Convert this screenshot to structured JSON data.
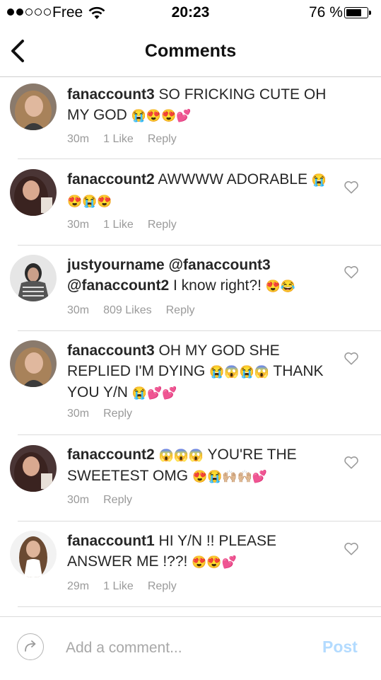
{
  "status_bar": {
    "carrier": "Free",
    "time": "20:23",
    "battery_percent": "76 %",
    "battery_level": 0.76,
    "signal_bars_filled": 2,
    "signal_bars_total": 5
  },
  "header": {
    "title": "Comments"
  },
  "comments": [
    {
      "username": "fanaccount3",
      "text": "SO FRICKING CUTE OH MY GOD",
      "emojis": "😭😍😍💕",
      "time": "30m",
      "likes": "1 Like",
      "reply": "Reply"
    },
    {
      "username": "fanaccount2",
      "text": "AWWWW ADORABLE",
      "emojis": "😭😍😭😍",
      "time": "30m",
      "likes": "1 Like",
      "reply": "Reply"
    },
    {
      "username": "justyourname",
      "mention_1": "@fanaccount3",
      "mention_2": "@fanaccount2",
      "text": "I know right?!",
      "emojis": "😍😂",
      "time": "30m",
      "likes": "809 Likes",
      "reply": "Reply"
    },
    {
      "username": "fanaccount3",
      "text": "OH MY GOD SHE REPLIED I'M DYING",
      "emojis_1": "😭😱😭😱",
      "text_2": "THANK YOU Y/N",
      "emojis_2": "😭💕💕",
      "time": "30m",
      "reply": "Reply"
    },
    {
      "username": "fanaccount2",
      "emojis_1": "😱😱😱",
      "text": "YOU'RE THE SWEETEST OMG",
      "emojis_2": "😍😭🙌🏼🙌🏼💕",
      "time": "30m",
      "reply": "Reply"
    },
    {
      "username": "fanaccount1",
      "text": "HI Y/N !! PLEASE ANSWER ME !??!",
      "emojis": "😍😍💕",
      "time": "29m",
      "likes": "1 Like",
      "reply": "Reply"
    }
  ],
  "composer": {
    "placeholder": "Add a comment...",
    "post_label": "Post"
  },
  "colors": {
    "post_disabled": "#b3dbff",
    "meta_gray": "#9a9a9a",
    "divider": "#dbdbdb"
  }
}
